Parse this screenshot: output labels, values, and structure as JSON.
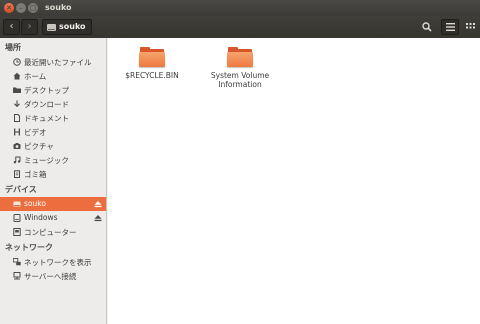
{
  "window": {
    "title": "souko"
  },
  "toolbar": {
    "back_label": "‹",
    "forward_label": "›",
    "breadcrumb": "souko"
  },
  "sidebar": {
    "sections": [
      {
        "title": "場所"
      },
      {
        "title": "デバイス"
      },
      {
        "title": "ネットワーク"
      }
    ],
    "places": [
      {
        "label": "最近開いたファイル",
        "icon": "clock-icon"
      },
      {
        "label": "ホーム",
        "icon": "home-icon"
      },
      {
        "label": "デスクトップ",
        "icon": "desktop-folder-icon"
      },
      {
        "label": "ダウンロード",
        "icon": "download-icon"
      },
      {
        "label": "ドキュメント",
        "icon": "document-icon"
      },
      {
        "label": "ビデオ",
        "icon": "video-icon"
      },
      {
        "label": "ピクチャ",
        "icon": "camera-icon"
      },
      {
        "label": "ミュージック",
        "icon": "music-icon"
      },
      {
        "label": "ゴミ箱",
        "icon": "trash-icon"
      }
    ],
    "devices": [
      {
        "label": "souko",
        "icon": "drive-icon",
        "selected": true,
        "eject": true
      },
      {
        "label": "Windows",
        "icon": "drive-icon",
        "selected": false,
        "eject": true
      },
      {
        "label": "コンピューター",
        "icon": "computer-icon",
        "selected": false,
        "eject": false
      }
    ],
    "network": [
      {
        "label": "ネットワークを表示",
        "icon": "network-icon"
      },
      {
        "label": "サーバーへ接続",
        "icon": "server-icon"
      }
    ]
  },
  "files": [
    {
      "name": "$RECYCLE.BIN",
      "icon": "folder-icon"
    },
    {
      "name": "System Volume Information",
      "icon": "folder-icon"
    }
  ],
  "colors": {
    "accent": "#ec6d3d",
    "folder": "#ef7a3e",
    "titlebar": "#3c3b37"
  }
}
